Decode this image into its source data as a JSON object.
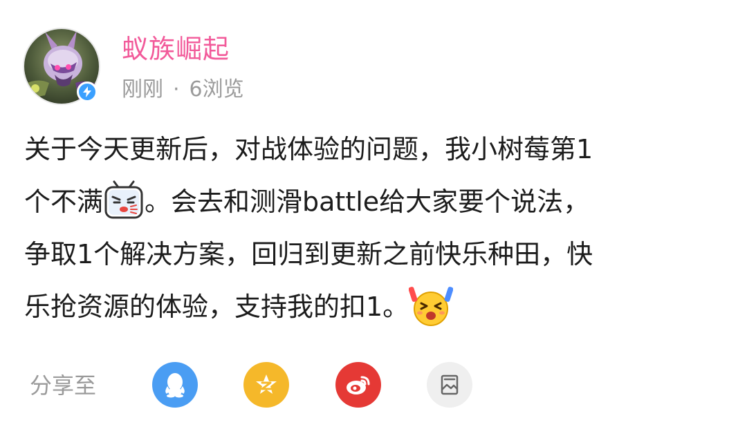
{
  "post": {
    "author": {
      "name": "蚁族崛起",
      "verified": true
    },
    "time": "刚刚",
    "separator": "·",
    "views": "6浏览",
    "content": {
      "line1": "关于今天更新后，对战体验的问题，我小树莓第1",
      "line2_a": "个不满",
      "line2_b": "。会去和测滑battle给大家要个说法，",
      "line3": "争取1个解决方案，回归到更新之前快乐种田，快",
      "line4": "乐抢资源的体验，支持我的扣1。"
    },
    "emojis": [
      "angry-tv-emoji",
      "cheering-emoji"
    ]
  },
  "share": {
    "label": "分享至",
    "targets": [
      {
        "name": "qq",
        "icon": "qq-penguin-icon",
        "color": "#4a9df3"
      },
      {
        "name": "qzone",
        "icon": "qzone-star-icon",
        "color": "#f5b82a"
      },
      {
        "name": "weibo",
        "icon": "weibo-icon",
        "color": "#e53935"
      },
      {
        "name": "image",
        "icon": "image-icon",
        "color": "#efefef"
      }
    ]
  },
  "colors": {
    "username": "#f25a9a",
    "meta": "#9a9a9a",
    "text": "#1c1c1c",
    "badge": "#3aa0ff"
  }
}
